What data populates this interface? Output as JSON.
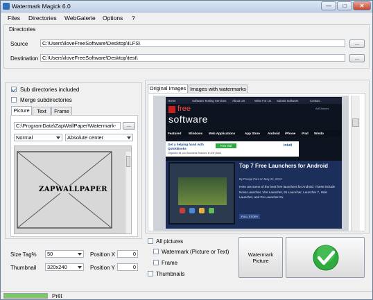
{
  "window": {
    "title": "Watermark Magick 6.0",
    "minimize": "—",
    "maximize": "□",
    "close": "✕"
  },
  "menu": [
    "Files",
    "Directories",
    "WebGalerie",
    "Options",
    "?"
  ],
  "directories": {
    "section_label": "Directories",
    "source_label": "Source",
    "source_value": "C:\\Users\\iloveFreeSoftware\\Desktop\\ILFS\\",
    "destination_label": "Destination",
    "destination_value": "C:\\Users\\iloveFreeSoftware\\Desktop\\test\\",
    "browse_label": "..."
  },
  "options": {
    "subdirs_label": "Sub directories included",
    "subdirs_checked": true,
    "merge_label": "Merge subdirectories",
    "merge_checked": false
  },
  "left_tabs": [
    "Picture",
    "Text",
    "Frame"
  ],
  "picture": {
    "path": "C:\\ProgramData\\ZapWallPaper\\Watermark-",
    "browse_label": "...",
    "blend_mode": "Normal",
    "position_mode": "Absolute center",
    "preview_text": "ZAPWALLPAPER"
  },
  "sizing": {
    "size_label": "Size Tag%",
    "size_value": "50",
    "thumbnail_label": "Thumbnail",
    "thumbnail_value": "320x240",
    "pos_x_label": "Position X",
    "pos_x_value": "0",
    "pos_y_label": "Position Y",
    "pos_y_value": "0"
  },
  "right_tabs": [
    "Original Images",
    "Images with watermarks"
  ],
  "preview": {
    "site_nav": [
      "Home",
      "Software Testing Services",
      "About US",
      "Write For Us",
      "Submit Software",
      "Contact"
    ],
    "logo_text": "free",
    "logo_sub": "software",
    "adchoices": "AdChoices",
    "categories": [
      "Featured",
      "Windows",
      "Web Applications",
      "App Store",
      "Android",
      "iPhone",
      "iPad",
      "Windo"
    ],
    "ad_text": "Get a helping hand with QuickBooks",
    "ad_button": "Free trial",
    "ad_subtext": "Organize all your business finances in one place",
    "ad_brand": "intuit",
    "article_title": "Top 7 Free Launchers for Android",
    "article_meta": "By Pranjal Pant on May 22, 2013",
    "article_body": "Here are some of the best free launchers for Android. These include Nova Launcher, Vire Launcher, 91 Launcher, Launcher 7, Holo Launcher, and Go Launcher Ex",
    "full_story": "FULL STORY"
  },
  "apply": {
    "all_pictures_label": "All pictures",
    "watermark_label": "Watermark (Picture or Text)",
    "frame_label": "Frame",
    "thumbnails_label": "Thumbnails",
    "watermark_button": "Watermark Picture"
  },
  "status": {
    "text": "Prêt",
    "progress": 1.0
  },
  "colors": {
    "accent_green": "#2eaa3f",
    "site_dark": "#101624",
    "site_red": "#c8201e",
    "site_blue_bar": "#1c2f5a"
  }
}
